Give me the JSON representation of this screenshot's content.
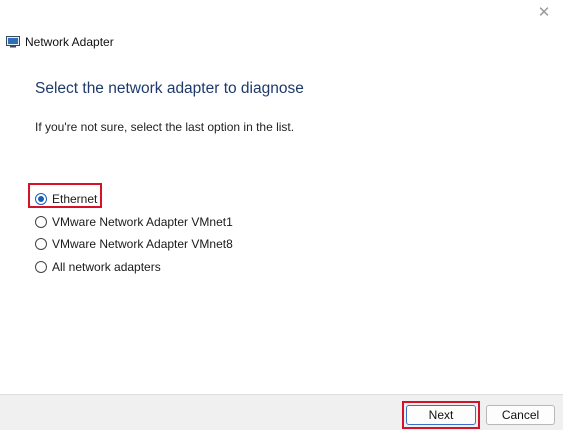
{
  "window": {
    "title": "Network Adapter",
    "close_glyph": "✕",
    "app_icon": "network-adapter-icon"
  },
  "main": {
    "heading": "Select the network adapter to diagnose",
    "hint": "If you're not sure, select the last option in the list."
  },
  "options": [
    {
      "label": "Ethernet",
      "selected": true
    },
    {
      "label": "VMware Network Adapter VMnet1",
      "selected": false
    },
    {
      "label": "VMware Network Adapter VMnet8",
      "selected": false
    },
    {
      "label": "All network adapters",
      "selected": false
    }
  ],
  "footer": {
    "next_label": "Next",
    "cancel_label": "Cancel"
  },
  "colors": {
    "accent": "#1a5fb4",
    "heading": "#1e3a6b",
    "highlight": "#d4122a"
  }
}
